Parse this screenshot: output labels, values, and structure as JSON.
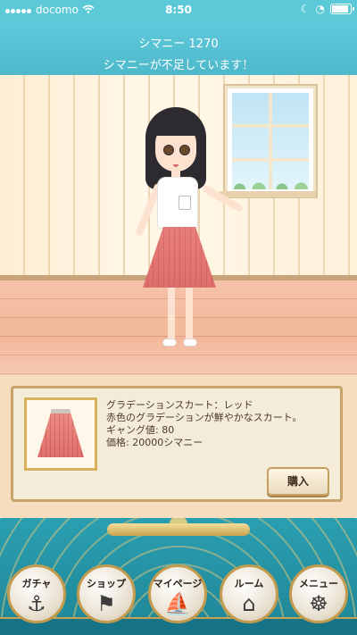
{
  "status_bar": {
    "carrier": "docomo",
    "time": "8:50"
  },
  "header": {
    "currency_label": "シマニー 1270",
    "warning": "シマニーが不足しています！"
  },
  "item": {
    "name": "グラデーションスカート：レッド",
    "description": "赤色のグラデーションが鮮やかなスカート。",
    "gyang": "ギャング値: 80",
    "price": "価格: 20000シマニー",
    "buy_label": "購入",
    "icon": "skirt"
  },
  "nav": {
    "items": [
      {
        "label": "ガチャ",
        "icon": "anchor-icon"
      },
      {
        "label": "ショップ",
        "icon": "pirate-flag-icon"
      },
      {
        "label": "マイページ",
        "icon": "ship-icon"
      },
      {
        "label": "ルーム",
        "icon": "castle-icon"
      },
      {
        "label": "メニュー",
        "icon": "ship-wheel-icon"
      }
    ]
  },
  "colors": {
    "accent": "#5cc9d8",
    "gold": "#c9a24f",
    "skirt": "#e06f6b"
  }
}
